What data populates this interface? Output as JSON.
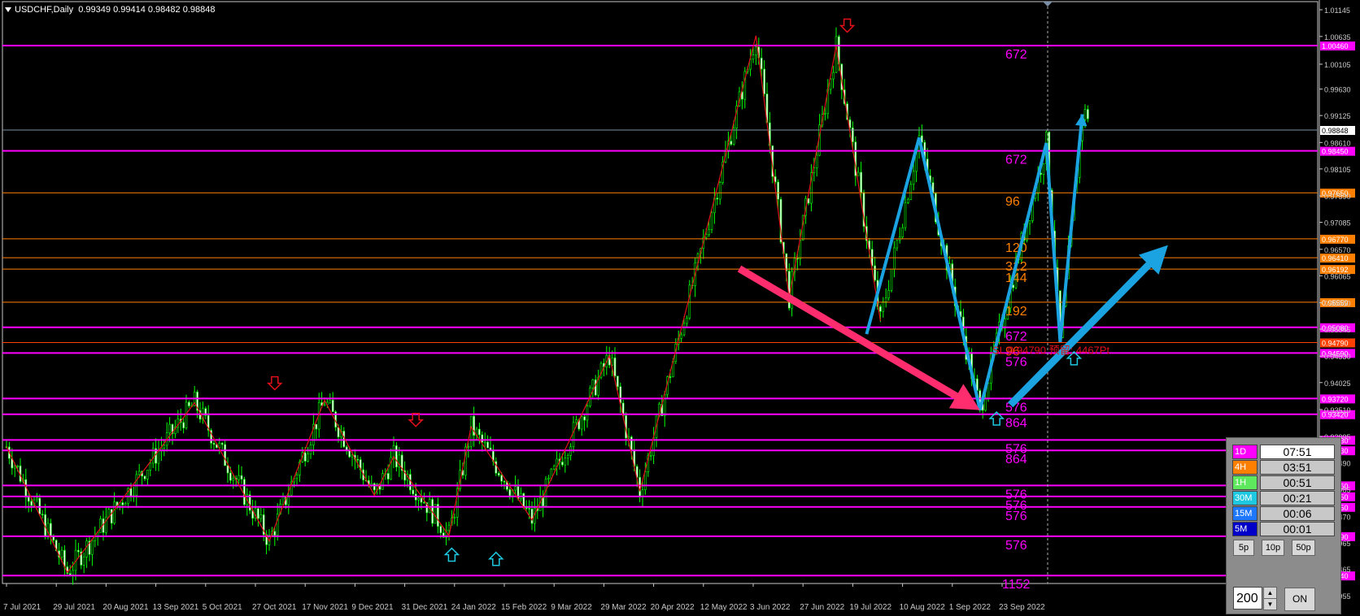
{
  "header": {
    "symbol": "USDCHF,Daily",
    "ohlc": "0.99349 0.99414 0.98482 0.98848"
  },
  "chart_data": {
    "type": "candlestick",
    "ylim": [
      0.89955,
      1.01145
    ],
    "y_ticks": [
      "1.01145",
      "1.00635",
      "1.00105",
      "0.99630",
      "0.99125",
      "0.98610",
      "0.98105",
      "0.97590",
      "0.97085",
      "0.96570",
      "0.96065",
      "0.95550",
      "0.95045",
      "0.94530",
      "0.94025",
      "0.93510",
      "0.92995",
      "0.92490",
      "0.91985",
      "0.91470",
      "0.90965",
      "0.90465",
      "0.89955"
    ],
    "x_labels": [
      "7 Jul 2021",
      "29 Jul 2021",
      "20 Aug 2021",
      "13 Sep 2021",
      "5 Oct 2021",
      "27 Oct 2021",
      "17 Nov 2021",
      "9 Dec 2021",
      "31 Dec 2021",
      "24 Jan 2022",
      "15 Feb 2022",
      "9 Mar 2022",
      "29 Mar 2022",
      "20 Apr 2022",
      "12 May 2022",
      "3 Jun 2022",
      "27 Jun 2022",
      "19 Jul 2022",
      "10 Aug 2022",
      "1 Sep 2022",
      "23 Sep 2022"
    ],
    "current_price": "0.98848",
    "levels": [
      {
        "price": 1.0046,
        "label": "1.00460",
        "color": "#ff00ff",
        "count": "672"
      },
      {
        "price": 0.9845,
        "label": "0.98450",
        "color": "#ff00ff",
        "count": "672"
      },
      {
        "price": 0.9765,
        "label": "0.97650",
        "color": "#ff8000",
        "count": "96"
      },
      {
        "price": 0.9677,
        "label": "0.96770",
        "color": "#ff8000",
        "count": "120"
      },
      {
        "price": 0.9641,
        "label": "0.96410",
        "color": "#ff8000",
        "count": "312"
      },
      {
        "price": 0.96192,
        "label": "0.96192",
        "color": "#ff8000",
        "count": "144"
      },
      {
        "price": 0.95559,
        "label": "0.95559",
        "color": "#ff8000",
        "count": "192"
      },
      {
        "price": 0.9508,
        "label": "0.95080",
        "color": "#ff00ff",
        "count": "672"
      },
      {
        "price": 0.9479,
        "label": "0.94790",
        "color": "#ff4000",
        "count": "96"
      },
      {
        "price": 0.9459,
        "label": "0.94590",
        "color": "#ff00ff",
        "count": "576"
      },
      {
        "price": 0.9372,
        "label": "0.93720",
        "color": "#ff00ff",
        "count": "576"
      },
      {
        "price": 0.9342,
        "label": "0.93420",
        "color": "#ff00ff",
        "count": "864"
      },
      {
        "price": 0.9293,
        "label": "0.92930",
        "color": "#ff00ff",
        "count": "576"
      },
      {
        "price": 0.9273,
        "label": "0.92730",
        "color": "#ff00ff",
        "count": "864"
      },
      {
        "price": 0.9206,
        "label": "0.92060",
        "color": "#ff00ff",
        "count": "576"
      },
      {
        "price": 0.9185,
        "label": "0.91850",
        "color": "#ff00ff",
        "count": "576"
      },
      {
        "price": 0.9165,
        "label": "0.91650",
        "color": "#ff00ff",
        "count": "576"
      },
      {
        "price": 0.9109,
        "label": "0.91090",
        "color": "#ff00ff",
        "count": "576"
      },
      {
        "price": 0.9034,
        "label": "0.90340",
        "color": "#ff00ff",
        "count": "1152"
      }
    ],
    "sl_text": "SL 0.94790 预留: 4467Pt",
    "zigzag_red": [
      [
        0,
        0.928
      ],
      [
        22,
        0.904
      ],
      [
        68,
        0.9364
      ],
      [
        95,
        0.91
      ],
      [
        115,
        0.9369
      ],
      [
        133,
        0.9187
      ],
      [
        140,
        0.9261
      ],
      [
        160,
        0.911
      ],
      [
        168,
        0.9318
      ],
      [
        190,
        0.914
      ],
      [
        218,
        0.9454
      ],
      [
        229,
        0.9195
      ],
      [
        271,
        1.0065
      ],
      [
        283,
        0.9565
      ],
      [
        300,
        1.0045
      ],
      [
        316,
        0.952
      ]
    ],
    "zigzag_blue": [
      [
        311,
        0.9495
      ],
      [
        330,
        0.987
      ],
      [
        352,
        0.935
      ],
      [
        376,
        0.986
      ],
      [
        381,
        0.948
      ],
      [
        389,
        0.9915
      ]
    ],
    "arrows_big": [
      {
        "from": [
          265,
          0.962
        ],
        "to": [
          352,
          0.935
        ],
        "color": "#ff2d6e"
      },
      {
        "from": [
          363,
          0.936
        ],
        "to": [
          420,
          0.9665
        ],
        "color": "#1aa3e0"
      }
    ],
    "fractal_down": [
      [
        97,
        0.9395
      ],
      [
        148,
        0.9325
      ],
      [
        304,
        1.0078
      ]
    ],
    "fractal_up": [
      [
        161,
        0.908
      ],
      [
        177,
        0.9072
      ],
      [
        358,
        0.934
      ],
      [
        386,
        0.9455
      ]
    ]
  },
  "timer_panel": {
    "rows": [
      {
        "tf": "1D",
        "time": "07:51",
        "color": "#ff00ff"
      },
      {
        "tf": "4H",
        "time": "03:51",
        "color": "#ff8000"
      },
      {
        "tf": "1H",
        "time": "00:51",
        "color": "#5de85d"
      },
      {
        "tf": "30M",
        "time": "00:21",
        "color": "#1ec8e0"
      },
      {
        "tf": "15M",
        "time": "00:06",
        "color": "#1e78ff"
      },
      {
        "tf": "5M",
        "time": "00:01",
        "color": "#0000c8"
      }
    ],
    "buttons": [
      "5p",
      "10p",
      "50p"
    ],
    "bars_value": "200",
    "on_label": "ON"
  }
}
